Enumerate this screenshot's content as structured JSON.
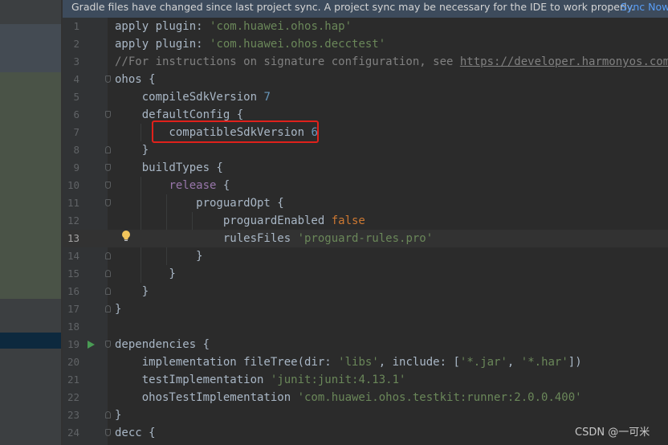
{
  "banner": {
    "message": "Gradle files have changed since last project sync. A project sync may be necessary for the IDE to work properly.",
    "action": "Sync Now"
  },
  "editor": {
    "current_line": 13,
    "lines": [
      {
        "n": "1",
        "segments": [
          {
            "t": "apply plugin: ",
            "c": "plain"
          },
          {
            "t": "'com.huawei.ohos.hap'",
            "c": "str"
          }
        ]
      },
      {
        "n": "2",
        "segments": [
          {
            "t": "apply plugin: ",
            "c": "plain"
          },
          {
            "t": "'com.huawei.ohos.decctest'",
            "c": "str"
          }
        ]
      },
      {
        "n": "3",
        "segments": [
          {
            "t": "//For instructions on signature configuration, see ",
            "c": "cmt"
          },
          {
            "t": "https://developer.harmonyos.com/cn/",
            "c": "link"
          }
        ]
      },
      {
        "n": "4",
        "segments": [
          {
            "t": "ohos {",
            "c": "plain"
          }
        ]
      },
      {
        "n": "5",
        "segments": [
          {
            "t": "    compileSdkVersion ",
            "c": "plain"
          },
          {
            "t": "7",
            "c": "num"
          }
        ]
      },
      {
        "n": "6",
        "segments": [
          {
            "t": "    defaultConfig {",
            "c": "plain"
          }
        ]
      },
      {
        "n": "7",
        "segments": [
          {
            "t": "        compatibleSdkVersion ",
            "c": "plain"
          },
          {
            "t": "6",
            "c": "num"
          }
        ]
      },
      {
        "n": "8",
        "segments": [
          {
            "t": "    }",
            "c": "plain"
          }
        ]
      },
      {
        "n": "9",
        "segments": [
          {
            "t": "    buildTypes {",
            "c": "plain"
          }
        ]
      },
      {
        "n": "10",
        "segments": [
          {
            "t": "        ",
            "c": "plain"
          },
          {
            "t": "release",
            "c": "release"
          },
          {
            "t": " {",
            "c": "plain"
          }
        ]
      },
      {
        "n": "11",
        "segments": [
          {
            "t": "            proguardOpt {",
            "c": "plain"
          }
        ]
      },
      {
        "n": "12",
        "segments": [
          {
            "t": "                proguardEnabled ",
            "c": "plain"
          },
          {
            "t": "false",
            "c": "kw"
          }
        ]
      },
      {
        "n": "13",
        "segments": [
          {
            "t": "                rulesFiles ",
            "c": "plain"
          },
          {
            "t": "'proguard-rules.pro'",
            "c": "str"
          }
        ]
      },
      {
        "n": "14",
        "segments": [
          {
            "t": "            }",
            "c": "plain"
          }
        ]
      },
      {
        "n": "15",
        "segments": [
          {
            "t": "        }",
            "c": "plain"
          }
        ]
      },
      {
        "n": "16",
        "segments": [
          {
            "t": "    }",
            "c": "plain"
          }
        ]
      },
      {
        "n": "17",
        "segments": [
          {
            "t": "}",
            "c": "plain"
          }
        ]
      },
      {
        "n": "18",
        "segments": []
      },
      {
        "n": "19",
        "segments": [
          {
            "t": "dependencies {",
            "c": "plain"
          }
        ]
      },
      {
        "n": "20",
        "segments": [
          {
            "t": "    implementation fileTree(",
            "c": "plain"
          },
          {
            "t": "dir: ",
            "c": "param"
          },
          {
            "t": "'libs'",
            "c": "str"
          },
          {
            "t": ", ",
            "c": "plain"
          },
          {
            "t": "include: ",
            "c": "param"
          },
          {
            "t": "[",
            "c": "plain"
          },
          {
            "t": "'*.jar'",
            "c": "str"
          },
          {
            "t": ", ",
            "c": "plain"
          },
          {
            "t": "'*.har'",
            "c": "str"
          },
          {
            "t": "])",
            "c": "plain"
          }
        ]
      },
      {
        "n": "21",
        "segments": [
          {
            "t": "    testImplementation ",
            "c": "plain"
          },
          {
            "t": "'junit:junit:4.13.1'",
            "c": "str"
          }
        ]
      },
      {
        "n": "22",
        "segments": [
          {
            "t": "    ohosTestImplementation ",
            "c": "plain"
          },
          {
            "t": "'com.huawei.ohos.testkit:runner:2.0.0.400'",
            "c": "str"
          }
        ]
      },
      {
        "n": "23",
        "segments": [
          {
            "t": "}",
            "c": "plain"
          }
        ]
      },
      {
        "n": "24",
        "segments": [
          {
            "t": "decc {",
            "c": "plain"
          }
        ]
      }
    ]
  },
  "gutter_icons": {
    "bulb": "lightbulb-icon",
    "run": "run-gutter-icon",
    "fold": "fold-marker-icon"
  },
  "watermark": "CSDN @一可米",
  "colors": {
    "string": "#6a8759",
    "number": "#6897bb",
    "keyword": "#cc7832",
    "comment": "#808080",
    "highlight_box": "#e0211b"
  }
}
